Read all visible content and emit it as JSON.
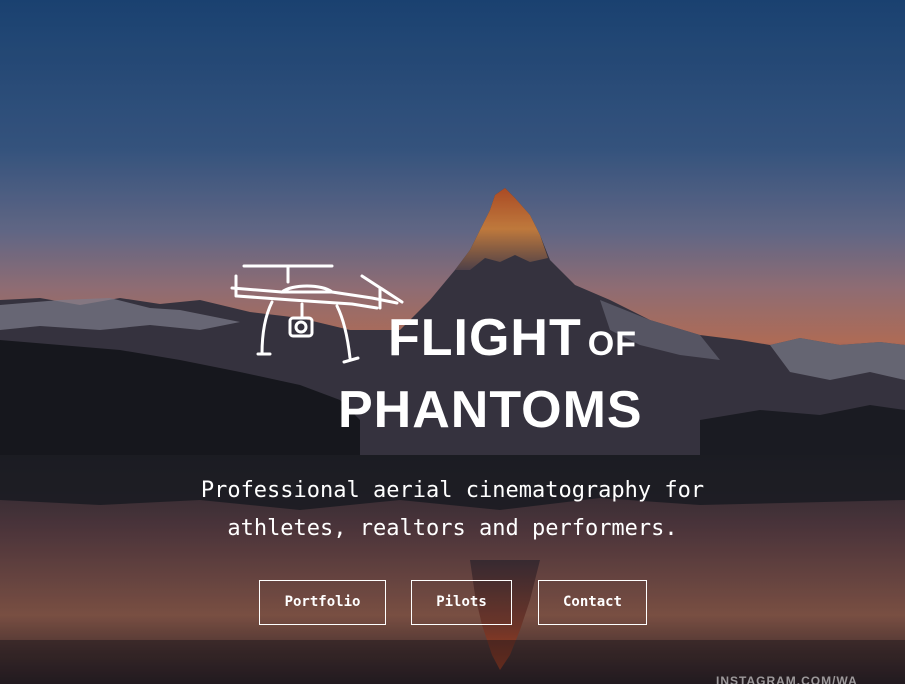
{
  "hero": {
    "title_line1": "FLIGHT",
    "title_of": "OF",
    "title_line2": "PHANTOMS",
    "tagline_line1": "Professional aerial cinematography for",
    "tagline_line2": "athletes, realtors and performers.",
    "background_image": "mountain-lake-sunset",
    "logo_icon": "drone-icon"
  },
  "nav": {
    "portfolio_label": "Portfolio",
    "pilots_label": "Pilots",
    "contact_label": "Contact"
  },
  "credit": {
    "text": "INSTAGRAM.COM/WA"
  },
  "colors": {
    "sky_top": "#1f4a7f",
    "sky_horizon": "#c77a5e",
    "peak_glow": "#d6733a",
    "text": "#ffffff",
    "button_border": "#ffffff"
  }
}
